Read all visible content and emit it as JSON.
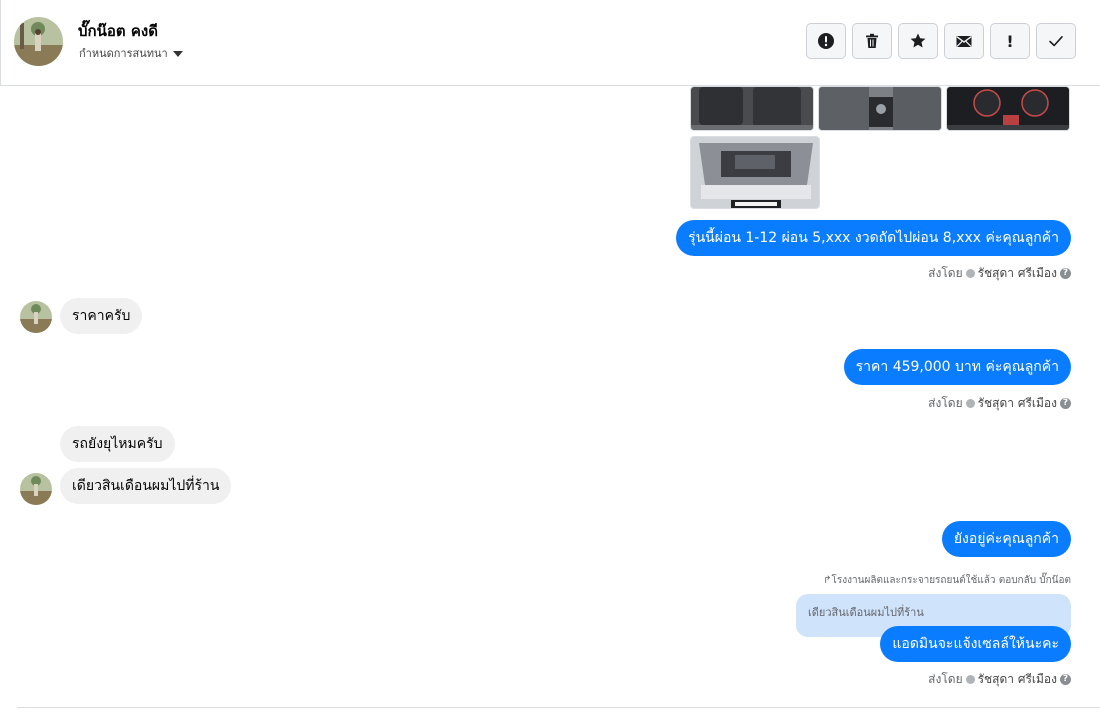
{
  "header": {
    "contact_name": "บั๊กน๊อต คงดี",
    "subtitle": "กำหนดการสนทนา",
    "actions": [
      {
        "name": "report-button",
        "icon": "exclamation-circle-icon"
      },
      {
        "name": "delete-button",
        "icon": "trash-icon"
      },
      {
        "name": "star-button",
        "icon": "star-icon"
      },
      {
        "name": "mark-unread-button",
        "icon": "envelope-icon"
      },
      {
        "name": "follow-up-button",
        "icon": "exclamation-icon",
        "label": "!"
      },
      {
        "name": "mark-done-button",
        "icon": "check-icon"
      }
    ]
  },
  "messages": {
    "m1": "รุ่นนี้ผ่อน 1-12 ผ่อน 5,xxx งวดถัดไปผ่อน 8,xxx ค่ะคุณลูกค้า",
    "m2": "ราคาครับ",
    "m3": "ราคา 459,000 บาท  ค่ะคุณลูกค้า",
    "m4": "รถยังยุไหมครับ",
    "m5": "เดียวสินเดือนผมไปที่ร้าน",
    "m6": "ยังอยู่ค่ะคุณลูกค้า",
    "m7": "แอดมินจะแจ้งเซลล์ให้นะคะ"
  },
  "sent_by": {
    "prefix": "ส่งโดย",
    "agent": "รัชสุดา ศรีเมือง",
    "help": "?"
  },
  "reply": {
    "meta": "โรงงานผลิตและกระจายรถยนต์ใช้แล้ว ตอบกลับ บั๊กน๊อต",
    "quoted": "เดียวสินเดือนผมไปที่ร้าน"
  },
  "colors": {
    "outgoing_bubble": "#0a7cff",
    "incoming_bubble": "#f0f0f0",
    "quoted_bubble": "#cfe3fb"
  }
}
